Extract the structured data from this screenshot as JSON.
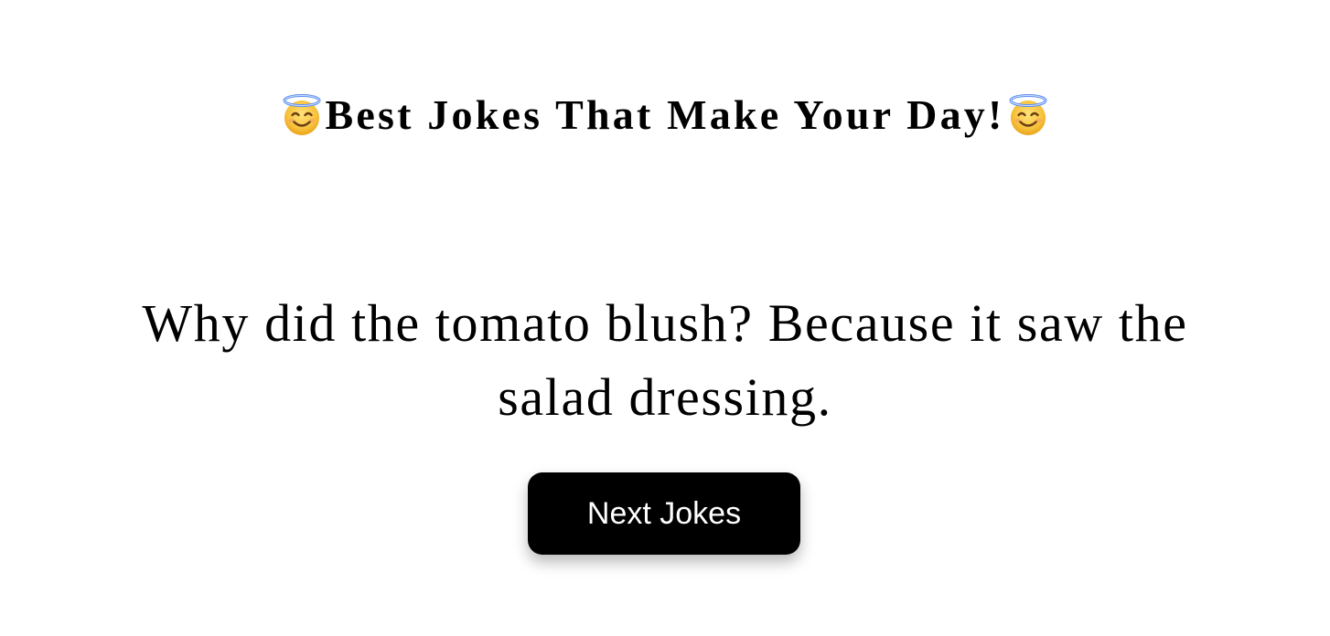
{
  "header": {
    "title": "Best Jokes That Make Your Day!",
    "left_icon": "smiling-face-with-halo-icon",
    "right_icon": "smiling-face-with-halo-icon"
  },
  "joke": {
    "text": "Why did the tomato blush? Because it saw the salad dressing."
  },
  "actions": {
    "next_label": "Next Jokes"
  },
  "colors": {
    "background": "#ffffff",
    "text": "#000000",
    "button_bg": "#000000",
    "button_text": "#ffffff",
    "emoji_face": "#f7c23b",
    "halo": "#5b8def"
  }
}
